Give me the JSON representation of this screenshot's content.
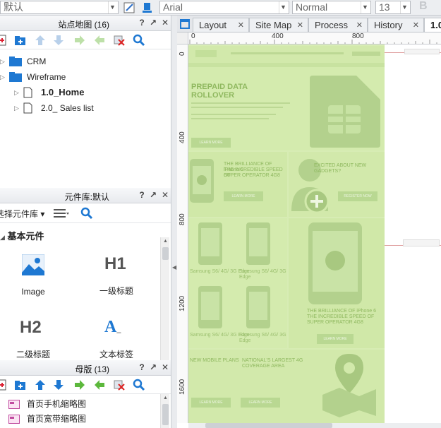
{
  "toolbar": {
    "font_group": "默认",
    "font_family": "Arial",
    "font_style": "Normal",
    "font_size": "13",
    "bold_label": "B"
  },
  "sitemap": {
    "title": "站点地图 (16)",
    "items": [
      {
        "label": "CRM",
        "type": "folder"
      },
      {
        "label": "Wireframe",
        "type": "folder"
      },
      {
        "label": "1.0_Home",
        "type": "page",
        "bold": true
      },
      {
        "label": "2.0_ Sales list",
        "type": "page",
        "bold": false
      }
    ]
  },
  "widgets": {
    "title": "元件库:默认",
    "library_select": "选择元件库",
    "group": "基本元件",
    "items": [
      {
        "label": "Image",
        "icon": "image-icon"
      },
      {
        "label": "一级标题",
        "icon": "heading-1-icon",
        "glyph": "H1"
      },
      {
        "label": "二级标题",
        "icon": "heading-2-icon",
        "glyph": "H2"
      },
      {
        "label": "文本标签",
        "icon": "text-label-icon",
        "glyph": "A"
      }
    ]
  },
  "masters": {
    "title": "母版 (13)",
    "items": [
      {
        "label": "首页手机缩略图"
      },
      {
        "label": "首页宽带缩略图"
      }
    ]
  },
  "tabs": [
    {
      "label": "Layout",
      "active": false
    },
    {
      "label": "Site Map",
      "active": false
    },
    {
      "label": "Process",
      "active": false
    },
    {
      "label": "History",
      "active": false
    },
    {
      "label": "1.0",
      "active": true
    }
  ],
  "ruler": {
    "h_marks": [
      "0",
      "400",
      "800"
    ],
    "v_marks": [
      "0",
      "400",
      "800",
      "1200",
      "1600"
    ]
  },
  "colors": {
    "accent_blue": "#1e78d2",
    "wireframe_green": "#d7ecb4",
    "wireframe_dark": "#afcd8a"
  },
  "canvas": {
    "hero_title_1": "PREPAID DATA",
    "hero_title_2": "ROLLOVER",
    "phone_heading_1": "THE BRILLIANCE OF iPhone 6",
    "phone_heading_2": "THE INCREDIBLE SPEED OF",
    "phone_heading_3": "SUPER OPERATOR 4G8",
    "excited_heading": "EXCITED ABOUT NEW GADGETS?",
    "big_phone_heading_1": "THE BRILLIANCE OF iPhone 6",
    "big_phone_heading_2": "THE INCREDIBLE SPEED OF",
    "big_phone_heading_3": "SUPER OPERATOR 4G8",
    "plans_heading": "NEW MOBILE PLANS",
    "coverage_heading_1": "NATIONAL'S LARGEST 4G",
    "coverage_heading_2": "COVERAGE AREA",
    "phone_caption": "Samsung S6/ 4G/ 3G Edge",
    "learn_more": "LEARN MORE",
    "register_now": "REGISTER NOW"
  }
}
